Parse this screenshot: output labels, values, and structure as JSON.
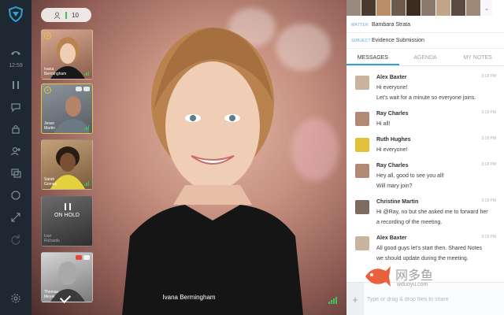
{
  "rail": {
    "time": "12:59",
    "icons": [
      "logo-shield-icon",
      "end-call-icon",
      "pause-icon",
      "chat-icon",
      "lock-icon",
      "add-user-icon",
      "screens-icon",
      "record-icon",
      "expand-icon",
      "refresh-icon",
      "settings-icon"
    ]
  },
  "stage": {
    "participant_count": "10",
    "speaker_name": "Ivana Bermingham"
  },
  "thumbnails": [
    {
      "name": "Ivana\nBermingham",
      "status": "active"
    },
    {
      "name": "Jesse\nMartin",
      "status": "active"
    },
    {
      "name": "Sarah\nGomez",
      "status": "active"
    },
    {
      "name": "Ivan\nRichards",
      "status": "hold",
      "hold_label": "ON HOLD"
    },
    {
      "name": "Thomas\nMeyer",
      "status": "active"
    }
  ],
  "panel": {
    "matter_key": "MATTER",
    "matter_value": "Bambara Strata",
    "subject_key": "SUBJECT",
    "subject_value": "Evidence Submission",
    "tabs": [
      {
        "label": "MESSAGES",
        "active": true
      },
      {
        "label": "AGENDA",
        "active": false
      },
      {
        "label": "MY NOTES",
        "active": false
      }
    ],
    "messages": [
      {
        "author": "Alex Baxter",
        "time": "3:18 PM",
        "lines": [
          "Hi everyone!",
          "Let's wait for a minute so everyone joins."
        ],
        "avatar_color": "#c9b59b"
      },
      {
        "author": "Ray Charles",
        "time": "3:18 PM",
        "lines": [
          "Hi all!"
        ],
        "avatar_color": "#b08a72"
      },
      {
        "author": "Ruth Hughes",
        "time": "3:18 PM",
        "lines": [
          "Hi everyone!"
        ],
        "avatar_color": "#e2c23b"
      },
      {
        "author": "Ray Charles",
        "time": "3:18 PM",
        "lines": [
          "Hey all, good to see you all!",
          "Will mary join?"
        ],
        "avatar_color": "#b08a72"
      },
      {
        "author": "Christine Martin",
        "time": "3:18 PM",
        "lines": [
          "Hi @Ray, no but she asked me to forward her",
          "a recording of the meeting."
        ],
        "avatar_color": "#7d6a60"
      },
      {
        "author": "Alex Baxter",
        "time": "3:18 PM",
        "lines": [
          "All good guys let's start then. Shared Notes",
          "we should update during the meeting."
        ],
        "avatar_color": "#c9b59b"
      }
    ],
    "composer_placeholder": "Type or drag & drop files to share"
  },
  "watermark": {
    "cn": "网多鱼",
    "url": "wduoyu.com"
  },
  "colors": {
    "accent": "#2fa3d4",
    "signal": "#3ec35a",
    "rail": "#1e2833"
  }
}
